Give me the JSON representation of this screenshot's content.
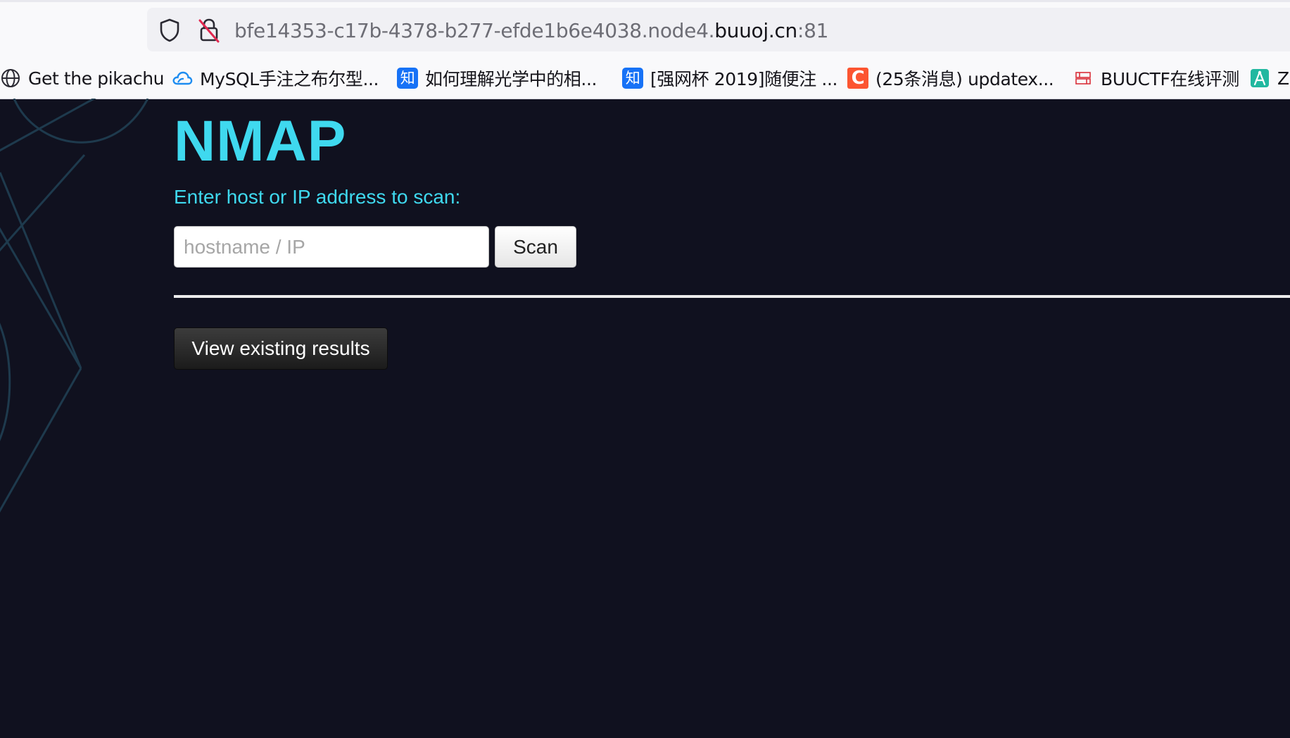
{
  "browser": {
    "url": {
      "prefix": "bfe14353-c17b-4378-b277-efde1b6e4038.node4.",
      "domain": "buuoj.cn",
      "port": ":81"
    },
    "bookmarks": [
      {
        "label": "Get the pikachu",
        "icon": "globe-icon"
      },
      {
        "label": "MySQL手注之布尔型...",
        "icon": "cloud-icon"
      },
      {
        "label": "如何理解光学中的相...",
        "icon": "zhihu-icon",
        "badge": "知"
      },
      {
        "label": "[强网杯 2019]随便注 ...",
        "icon": "zhihu-icon",
        "badge": "知"
      },
      {
        "label": "(25条消息) updatex...",
        "icon": "csdn-icon",
        "badge": "C"
      },
      {
        "label": "BUUCTF在线评测",
        "icon": "buuctf-icon"
      },
      {
        "label": "Z",
        "icon": "compass-icon"
      }
    ]
  },
  "page": {
    "title": "NMAP",
    "prompt": "Enter host or IP address to scan:",
    "input": {
      "placeholder": "hostname / IP",
      "value": ""
    },
    "scan_label": "Scan",
    "results_label": "View existing results"
  },
  "colors": {
    "background": "#10111f",
    "accent": "#3fd9ef",
    "decoration": "#1e3a4d"
  }
}
